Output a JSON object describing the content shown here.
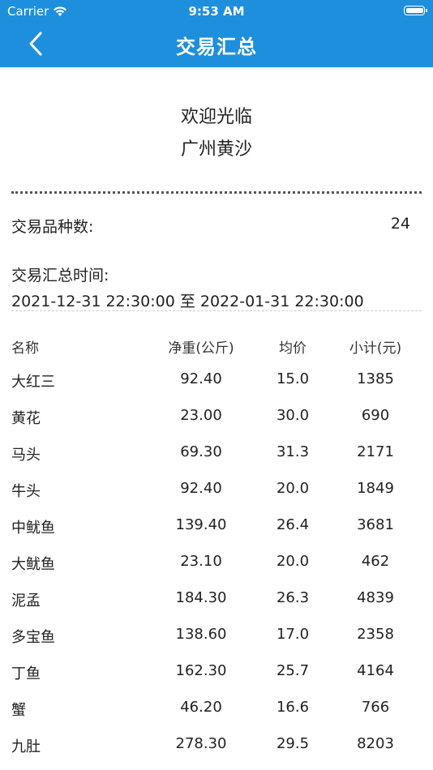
{
  "status": {
    "carrier": "Carrier",
    "time": "9:53 AM"
  },
  "header": {
    "title": "交易汇总"
  },
  "welcome": {
    "line1": "欢迎光临",
    "line2": "广州黄沙"
  },
  "summary": {
    "kind_label": "交易品种数:",
    "kind_value": "24",
    "time_label": "交易汇总时间:",
    "time_range": "2021-12-31 22:30:00 至 2022-01-31 22:30:00"
  },
  "table": {
    "headers": {
      "name": "名称",
      "weight": "净重(公斤)",
      "price": "均价",
      "subtotal": "小计(元)"
    },
    "rows": [
      {
        "name": "大红三",
        "weight": "92.40",
        "price": "15.0",
        "subtotal": "1385"
      },
      {
        "name": "黄花",
        "weight": "23.00",
        "price": "30.0",
        "subtotal": "690"
      },
      {
        "name": "马头",
        "weight": "69.30",
        "price": "31.3",
        "subtotal": "2171"
      },
      {
        "name": "牛头",
        "weight": "92.40",
        "price": "20.0",
        "subtotal": "1849"
      },
      {
        "name": "中鱿鱼",
        "weight": "139.40",
        "price": "26.4",
        "subtotal": "3681"
      },
      {
        "name": "大鱿鱼",
        "weight": "23.10",
        "price": "20.0",
        "subtotal": "462"
      },
      {
        "name": "泥孟",
        "weight": "184.30",
        "price": "26.3",
        "subtotal": "4839"
      },
      {
        "name": "多宝鱼",
        "weight": "138.60",
        "price": "17.0",
        "subtotal": "2358"
      },
      {
        "name": "丁鱼",
        "weight": "162.30",
        "price": "25.7",
        "subtotal": "4164"
      },
      {
        "name": "蟹",
        "weight": "46.20",
        "price": "16.6",
        "subtotal": "766"
      },
      {
        "name": "九肚",
        "weight": "278.30",
        "price": "29.5",
        "subtotal": "8203"
      }
    ]
  }
}
